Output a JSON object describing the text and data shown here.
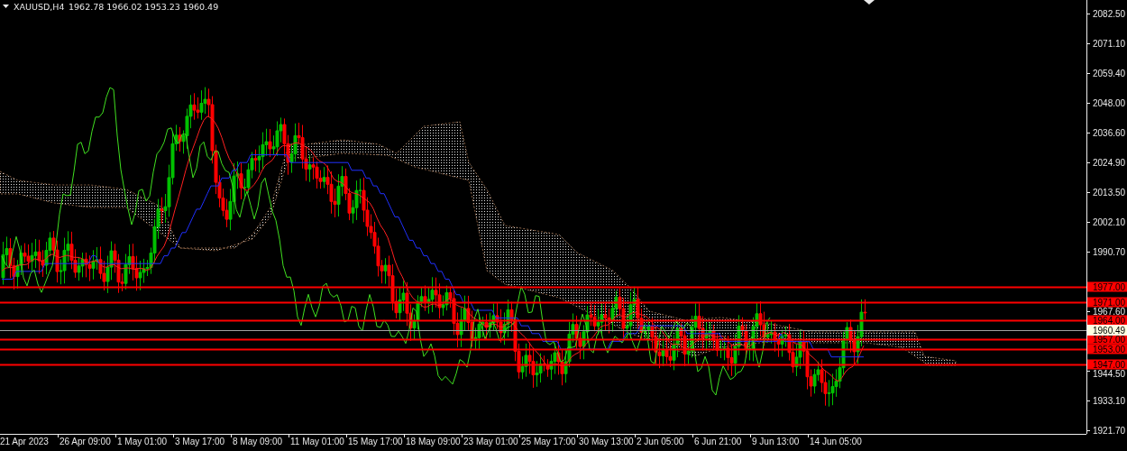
{
  "header": {
    "symbol": "XAUUSD,H4",
    "ohlc": "1962.78 1966.02 1953.23 1960.49"
  },
  "price_axis": {
    "ticks": [
      "2082.50",
      "2071.10",
      "2059.40",
      "2048.00",
      "2036.60",
      "2024.90",
      "2013.50",
      "2002.10",
      "1990.70",
      "1967.60",
      "1944.50",
      "1933.10",
      "1921.70"
    ]
  },
  "levels": [
    {
      "price": "1977.00"
    },
    {
      "price": "1971.00"
    },
    {
      "price": "1964.00"
    },
    {
      "price": "1957.00"
    },
    {
      "price": "1953.00"
    },
    {
      "price": "1947.00"
    }
  ],
  "current_price": "1960.49",
  "time_axis": {
    "labels": [
      "21 Apr 2023",
      "26 Apr 09:00",
      "1 May 01:00",
      "3 May 17:00",
      "8 May 09:00",
      "11 May 01:00",
      "15 May 17:00",
      "18 May 09:00",
      "23 May 01:00",
      "25 May 17:00",
      "30 May 13:00",
      "2 Jun 05:00",
      "6 Jun 21:00",
      "9 Jun 13:00",
      "14 Jun 05:00"
    ]
  }
}
